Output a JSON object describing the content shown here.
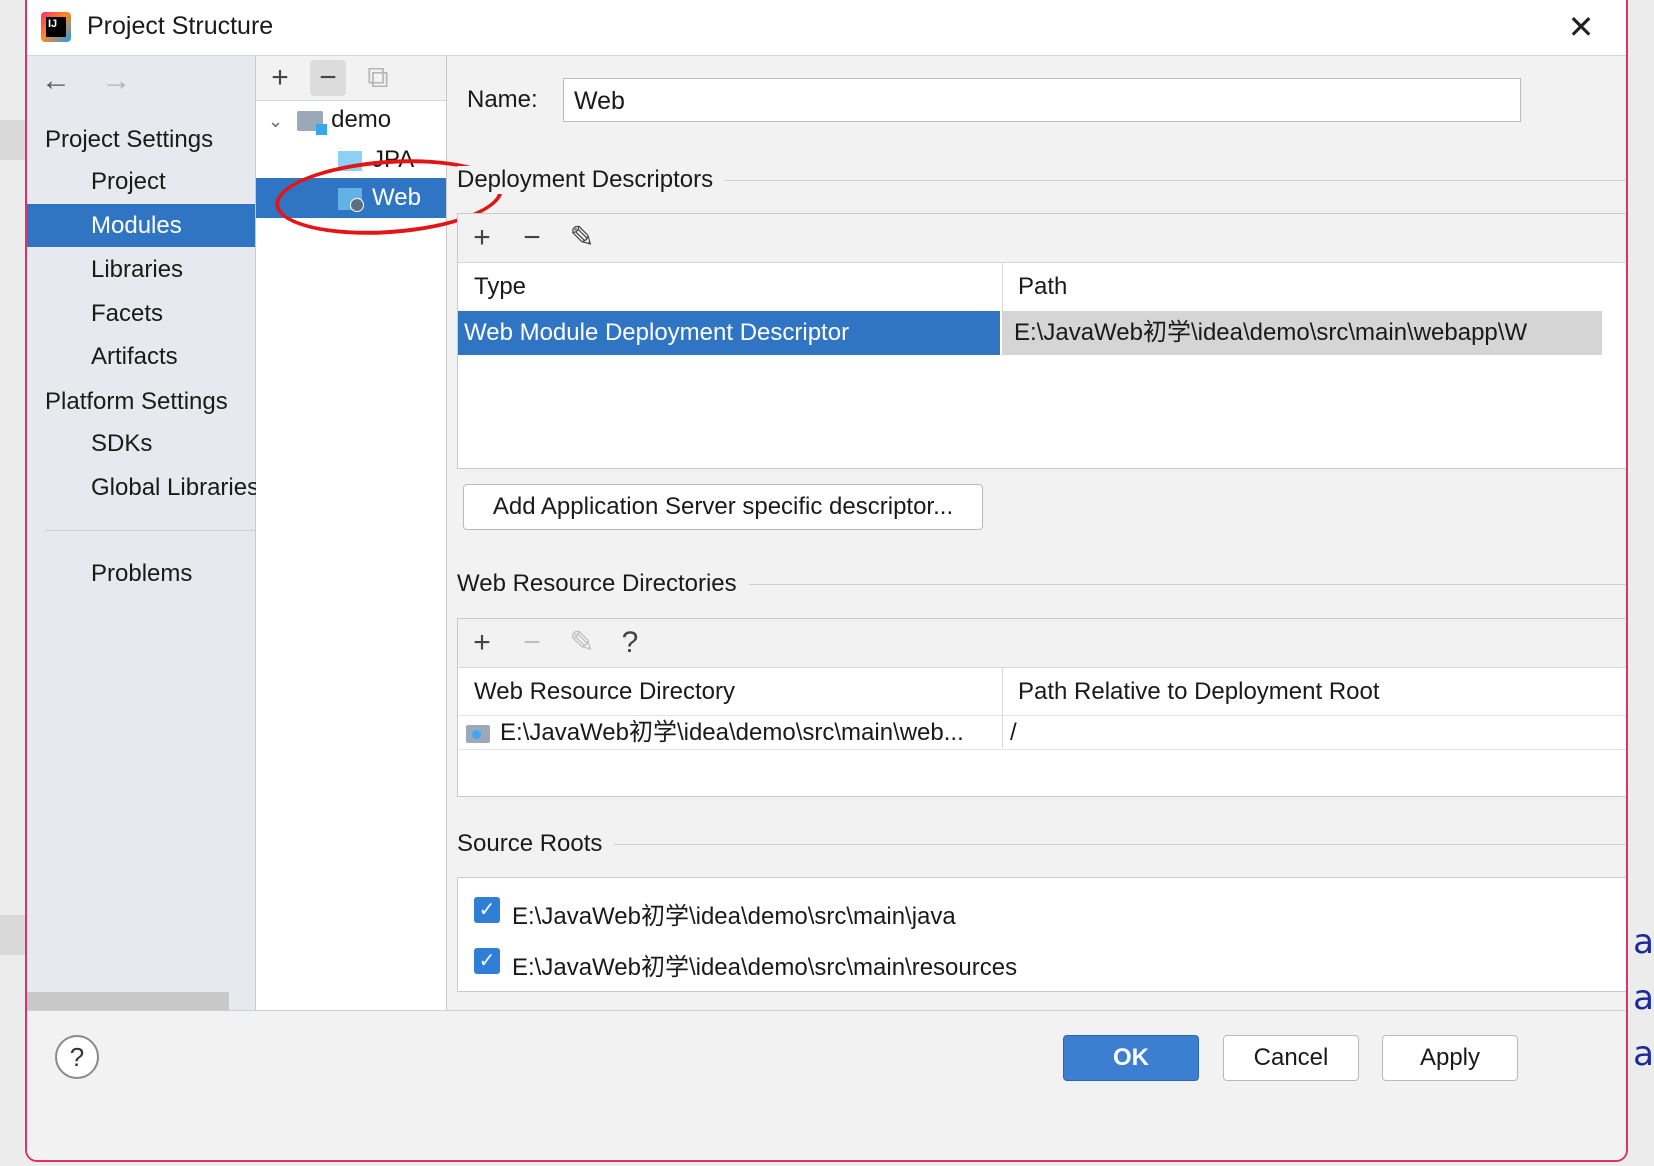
{
  "window": {
    "title": "Project Structure",
    "close_icon": "close-icon"
  },
  "nav": {
    "back_icon": "←",
    "forward_icon": "→",
    "project_settings_header": "Project Settings",
    "project_items": [
      "Project",
      "Modules",
      "Libraries",
      "Facets",
      "Artifacts"
    ],
    "platform_settings_header": "Platform Settings",
    "platform_items": [
      "SDKs",
      "Global Libraries"
    ],
    "problems": "Problems",
    "selected": "Modules"
  },
  "tree": {
    "toolbar": {
      "add": "+",
      "remove": "−",
      "copy": "⧉"
    },
    "root": "demo",
    "children": [
      "JPA",
      "Web"
    ],
    "selected": "Web"
  },
  "content": {
    "name_label": "Name:",
    "name_value": "Web",
    "deployment": {
      "title": "Deployment Descriptors",
      "columns": [
        "Type",
        "Path"
      ],
      "rows": [
        {
          "type": "Web Module Deployment Descriptor",
          "path": "E:\\JavaWeb初学\\idea\\demo\\src\\main\\webapp\\W"
        }
      ],
      "add_server_button": "Add Application Server specific descriptor..."
    },
    "web_resources": {
      "title": "Web Resource Directories",
      "columns": [
        "Web Resource Directory",
        "Path Relative to Deployment Root"
      ],
      "rows": [
        {
          "directory": "E:\\JavaWeb初学\\idea\\demo\\src\\main\\web...",
          "relative": "/"
        }
      ],
      "help_icon": "?"
    },
    "source_roots": {
      "title": "Source Roots",
      "items": [
        {
          "path": "E:\\JavaWeb初学\\idea\\demo\\src\\main\\java",
          "checked": true
        },
        {
          "path": "E:\\JavaWeb初学\\idea\\demo\\src\\main\\resources",
          "checked": true
        }
      ]
    }
  },
  "footer": {
    "help": "?",
    "ok": "OK",
    "cancel": "Cancel",
    "apply": "Apply"
  },
  "colors": {
    "selection": "#2f75c4",
    "annotation": "#e41515",
    "primary_button": "#3c7fd1"
  }
}
